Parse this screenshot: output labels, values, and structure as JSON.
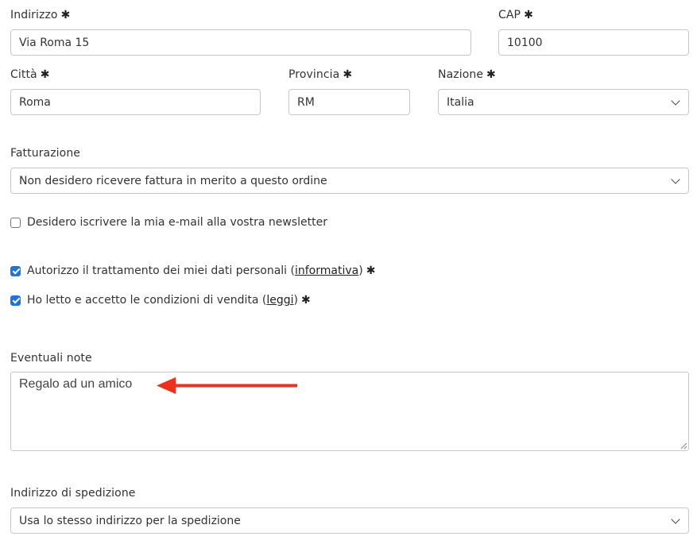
{
  "address": {
    "label": "Indirizzo",
    "required_mark": "✱",
    "value": "Via Roma 15"
  },
  "cap": {
    "label": "CAP",
    "required_mark": "✱",
    "value": "10100"
  },
  "city": {
    "label": "Città",
    "required_mark": "✱",
    "value": "Roma"
  },
  "province": {
    "label": "Provincia",
    "required_mark": "✱",
    "value": "RM"
  },
  "country": {
    "label": "Nazione",
    "required_mark": "✱",
    "selected": "Italia"
  },
  "billing": {
    "label": "Fatturazione",
    "selected": "Non desidero ricevere fattura in merito a questo ordine"
  },
  "newsletter": {
    "label": "Desidero iscrivere la mia e-mail alla vostra newsletter",
    "checked": false
  },
  "privacy": {
    "label_before": "Autorizzo il trattamento dei miei dati personali (",
    "link": "informativa",
    "label_after": ")",
    "required_mark": "✱",
    "checked": true
  },
  "terms": {
    "label_before": "Ho letto e accetto le condizioni di vendita (",
    "link": "leggi",
    "label_after": ")",
    "required_mark": "✱",
    "checked": true
  },
  "notes": {
    "label": "Eventuali note",
    "value": "Regalo ad un amico"
  },
  "shipping": {
    "label": "Indirizzo di spedizione",
    "selected": "Usa lo stesso indirizzo per la spedizione"
  },
  "annotation": {
    "arrow_color": "#f0301a",
    "checkbox_color": "#1a73e8"
  }
}
